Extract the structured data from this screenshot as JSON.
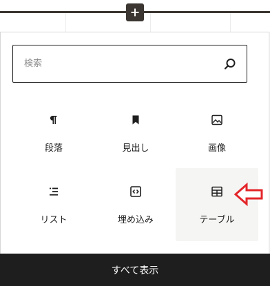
{
  "inserter": {
    "icon": "plus-icon"
  },
  "search": {
    "placeholder": "検索",
    "value": "",
    "icon": "search-icon"
  },
  "blocks": [
    {
      "label": "段落",
      "icon": "paragraph-icon"
    },
    {
      "label": "見出し",
      "icon": "heading-bookmark-icon"
    },
    {
      "label": "画像",
      "icon": "image-icon"
    },
    {
      "label": "リスト",
      "icon": "list-icon"
    },
    {
      "label": "埋め込み",
      "icon": "embed-icon"
    },
    {
      "label": "テーブル",
      "icon": "table-icon",
      "highlighted": true
    }
  ],
  "annotation": {
    "icon": "red-arrow-left-icon",
    "color": "#e3262a"
  },
  "footer": {
    "show_all_label": "すべて表示"
  },
  "colors": {
    "dark": "#1e1e1e",
    "separator": "#3b3631",
    "hover_bg": "#f5f5f4"
  }
}
